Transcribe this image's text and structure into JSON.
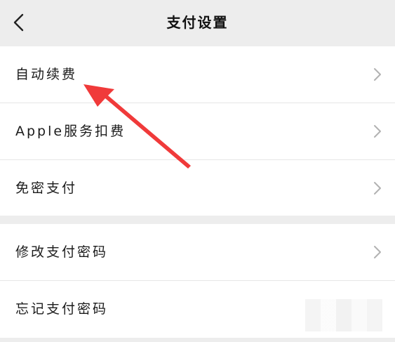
{
  "header": {
    "title": "支付设置"
  },
  "settings_group_1": [
    {
      "label": "自动续费"
    },
    {
      "label": "Apple服务扣费"
    },
    {
      "label": "免密支付"
    }
  ],
  "settings_group_2": [
    {
      "label": "修改支付密码"
    },
    {
      "label": "忘记支付密码"
    }
  ],
  "annotation": {
    "arrow_color": "#f03a3a"
  }
}
